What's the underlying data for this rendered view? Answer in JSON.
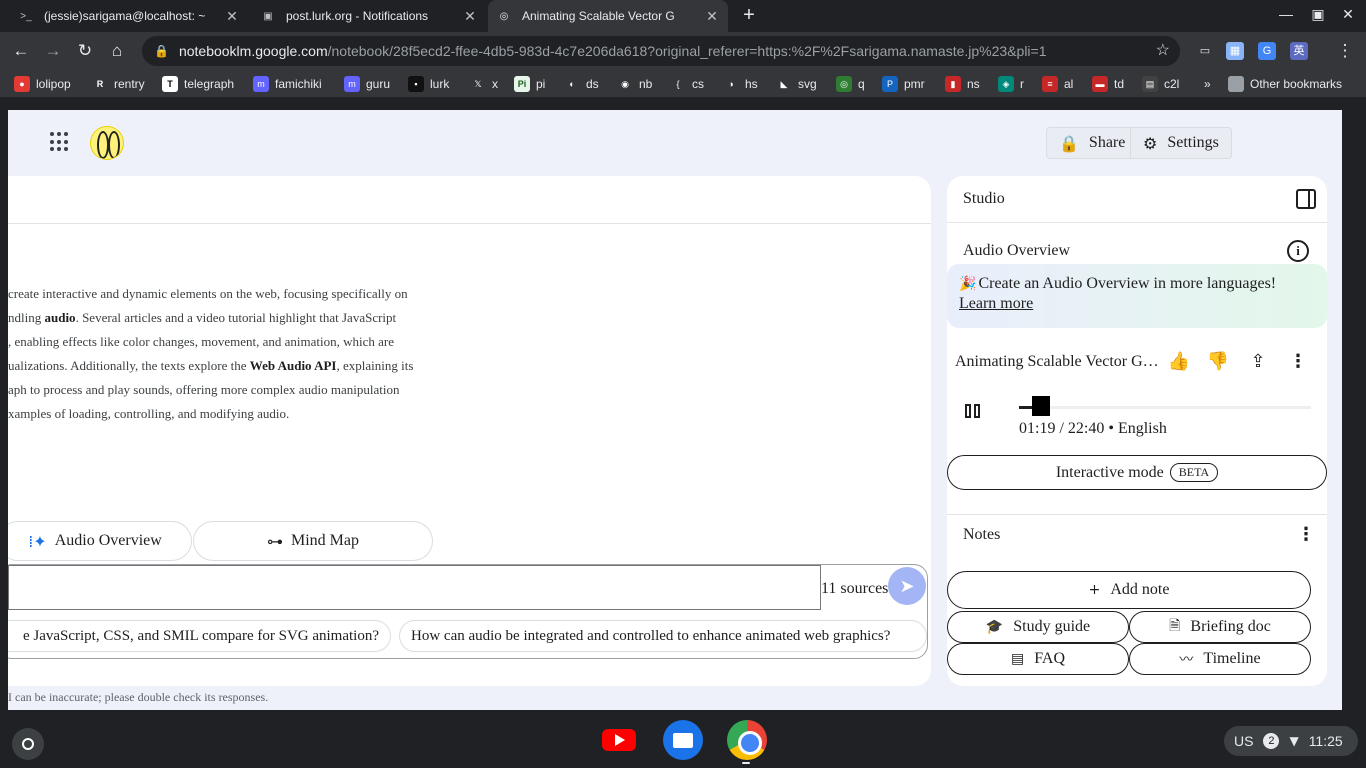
{
  "browser": {
    "tabs": [
      {
        "title": "(jessie)sarigama@localhost: ~",
        "active": false,
        "icon": "terminal-icon"
      },
      {
        "title": "post.lurk.org - Notifications",
        "active": false,
        "icon": "mastodon-icon"
      },
      {
        "title": "Animating Scalable Vector G",
        "active": true,
        "icon": "notebooklm-icon"
      }
    ],
    "url_host": "notebooklm.google.com",
    "url_path": "/notebook/28f5ecd2-ffee-4db5-983d-4c7e206da618?original_referer=https:%2F%2Fsarigama.namaste.jp%23&pli=1",
    "bookmarks": [
      {
        "label": "lolipop",
        "color": "#e53935",
        "glyph": "●"
      },
      {
        "label": "rentry",
        "color": "#35363a",
        "glyph": "R"
      },
      {
        "label": "telegraph",
        "color": "#ffffff",
        "glyph": "T"
      },
      {
        "label": "famichiki",
        "color": "#6364ff",
        "glyph": "m"
      },
      {
        "label": "guru",
        "color": "#6364ff",
        "glyph": "m"
      },
      {
        "label": "lurk",
        "color": "#111111",
        "glyph": "▪"
      },
      {
        "label": "x",
        "color": "#35363a",
        "glyph": "𝕏"
      },
      {
        "label": "pi",
        "color": "#e8f5e9",
        "glyph": "Pi"
      },
      {
        "label": "ds",
        "color": "#35363a",
        "glyph": "◐"
      },
      {
        "label": "nb",
        "color": "#35363a",
        "glyph": "◉"
      },
      {
        "label": "cs",
        "color": "#35363a",
        "glyph": "{"
      },
      {
        "label": "hs",
        "color": "#35363a",
        "glyph": "◑"
      },
      {
        "label": "svg",
        "color": "#35363a",
        "glyph": "◣"
      },
      {
        "label": "q",
        "color": "#2e7d32",
        "glyph": "◎"
      },
      {
        "label": "pmr",
        "color": "#1565c0",
        "glyph": "P"
      },
      {
        "label": "ns",
        "color": "#c62828",
        "glyph": "▮"
      },
      {
        "label": "r",
        "color": "#00897b",
        "glyph": "◈"
      },
      {
        "label": "al",
        "color": "#c62828",
        "glyph": "≡"
      },
      {
        "label": "td",
        "color": "#c62828",
        "glyph": "▬"
      },
      {
        "label": "c2l",
        "color": "#424242",
        "glyph": "▤"
      }
    ],
    "other_bookmarks": "Other bookmarks"
  },
  "header": {
    "share_label": "Share",
    "settings_label": "Settings"
  },
  "chat": {
    "summary_lines": [
      {
        "pre": "create interactive and dynamic elements on the web, focusing specifically on",
        "bold": "",
        "post": ""
      },
      {
        "pre": "ndling ",
        "bold": "audio",
        "post": ". Several articles and a video tutorial highlight that JavaScript"
      },
      {
        "pre": ", enabling effects like color changes, movement, and animation, which are",
        "bold": "",
        "post": ""
      },
      {
        "pre": "ualizations. Additionally, the texts explore the ",
        "bold": "Web Audio API",
        "post": ", explaining its"
      },
      {
        "pre": "aph to process and play sounds, offering more complex audio manipulation",
        "bold": "",
        "post": ""
      },
      {
        "pre": "xamples of loading, controlling, and modifying audio.",
        "bold": "",
        "post": ""
      }
    ],
    "audio_overview_label": "Audio Overview",
    "mind_map_label": "Mind Map",
    "sources_label": "11 sources",
    "suggestions": [
      "e JavaScript, CSS, and SMIL compare for SVG animation?",
      "How can audio be integrated and controlled to enhance animated web graphics?"
    ],
    "disclaimer": "I can be inaccurate; please double check its responses."
  },
  "studio": {
    "title": "Studio",
    "audio_overview_title": "Audio Overview",
    "banner_text": "Create an Audio Overview in more languages! ",
    "banner_link": "Learn more",
    "track_title": "Animating Scalable Vector Graphics",
    "progress": 0.058,
    "time_current": "01:19",
    "time_total": "22:40",
    "language": "English",
    "time_display": "01:19 / 22:40 • English",
    "interactive_label": "Interactive mode",
    "beta_label": "BETA",
    "notes_title": "Notes",
    "add_note_label": "Add note",
    "study_guide_label": "Study guide",
    "briefing_doc_label": "Briefing doc",
    "faq_label": "FAQ",
    "timeline_label": "Timeline"
  },
  "shelf": {
    "input_method": "US",
    "notification_count": "2",
    "clock": "11:25"
  }
}
